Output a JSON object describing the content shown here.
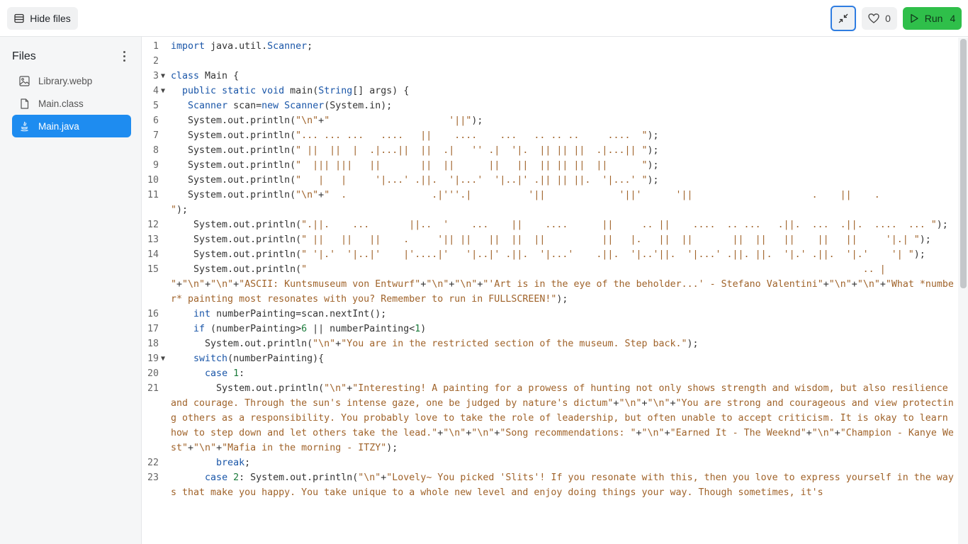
{
  "toolbar": {
    "hide_files_label": "Hide files",
    "like_count": "0",
    "run_label": "Run",
    "run_count": "4"
  },
  "sidebar": {
    "title": "Files",
    "files": [
      {
        "name": "Library.webp",
        "icon": "image-icon"
      },
      {
        "name": "Main.class",
        "icon": "file-icon"
      },
      {
        "name": "Main.java",
        "icon": "java-icon",
        "active": true
      }
    ]
  },
  "colors": {
    "accent": "#1e8cf0",
    "run_green": "#2fbf4a",
    "keyword": "#1a56a8",
    "string": "#a0632a"
  },
  "editor": {
    "language": "java",
    "lines": [
      {
        "n": "1",
        "text": "import java.util.Scanner;"
      },
      {
        "n": "2",
        "text": ""
      },
      {
        "n": "3",
        "fold": true,
        "text": "class Main {"
      },
      {
        "n": "4",
        "fold": true,
        "text": "  public static void main(String[] args) {"
      },
      {
        "n": "5",
        "text": "   Scanner scan=new Scanner(System.in);"
      },
      {
        "n": "6",
        "text": "   System.out.println(\"\\n\"+\"                     '||\");"
      },
      {
        "n": "7",
        "text": "   System.out.println(\"... ... ...   ....   ||    ....    ...   .. .. ..     ....  \");"
      },
      {
        "n": "8",
        "text": "   System.out.println(\" ||  ||  |  .|...||  ||  .|   '' .|  '|.  || || ||  .|...|| \");"
      },
      {
        "n": "9",
        "text": "   System.out.println(\"  ||| |||   ||       ||  ||      ||   ||  || || ||  ||      \");"
      },
      {
        "n": "10",
        "text": "   System.out.println(\"   |   |     '|...' .||.  '|...'  '|..|' .|| || ||.  '|...' \");"
      },
      {
        "n": "11",
        "text": "   System.out.println(\"\\n\"+\"  .               .|'''.|          '||             '||'      '||                     .    ||    .           \");"
      },
      {
        "n": "12",
        "text": "    System.out.println(\".||.    ...       ||..  '    ...    ||    ....      ||     .. ||    ....  .. ...   .||.  ...  .||.  ....  ... \");"
      },
      {
        "n": "13",
        "text": "    System.out.println(\" ||   ||   ||    .     '|| ||   ||  ||  ||          ||   |.   ||  ||       ||  ||   ||    ||   ||     '|.| \");"
      },
      {
        "n": "14",
        "text": "    System.out.println(\" '|.'  '|..|'    |'....|'   '|..|' .||.  '|...'    .||.  '|..'||.  '|...' .||. ||.  '|.' .||.  '|.'    '| \");"
      },
      {
        "n": "15",
        "text": "    System.out.println(\"                                                                                                  .. |  \"+\"\\n\"+\"\\n\"+\"ASCII: Kuntsmuseum von Entwurf\"+\"\\n\"+\"\\n\"+\"'Art is in the eye of the beholder...' - Stefano Valentini\"+\"\\n\"+\"\\n\"+\"What *number* painting most resonates with you? Remember to run in FULLSCREEN!\");"
      },
      {
        "n": "16",
        "text": "    int numberPainting=scan.nextInt();"
      },
      {
        "n": "17",
        "text": "    if (numberPainting>6 || numberPainting<1)"
      },
      {
        "n": "18",
        "text": "      System.out.println(\"\\n\"+\"You are in the restricted section of the museum. Step back.\");"
      },
      {
        "n": "19",
        "fold": true,
        "text": "    switch(numberPainting){"
      },
      {
        "n": "20",
        "text": "      case 1:"
      },
      {
        "n": "21",
        "text": "        System.out.println(\"\\n\"+\"Interesting! A painting for a prowess of hunting not only shows strength and wisdom, but also resilience and courage. Through the sun's intense gaze, one be judged by nature's dictum\"+\"\\n\"+\"\\n\"+\"You are strong and courageous and view protecting others as a responsibility. You probably love to take the role of leadership, but often unable to accept criticism. It is okay to learn how to step down and let others take the lead.\"+\"\\n\"+\"\\n\"+\"Song recommendations: \"+\"\\n\"+\"Earned It - The Weeknd\"+\"\\n\"+\"Champion - Kanye West\"+\"\\n\"+\"Mafia in the morning - ITZY\");"
      },
      {
        "n": "22",
        "text": "        break;"
      },
      {
        "n": "23",
        "text": "      case 2: System.out.println(\"\\n\"+\"Lovely~ You picked 'Slits'! If you resonate with this, then you love to express yourself in the ways that make you happy. You take unique to a whole new level and enjoy doing things your way. Though sometimes, it's"
      }
    ]
  }
}
